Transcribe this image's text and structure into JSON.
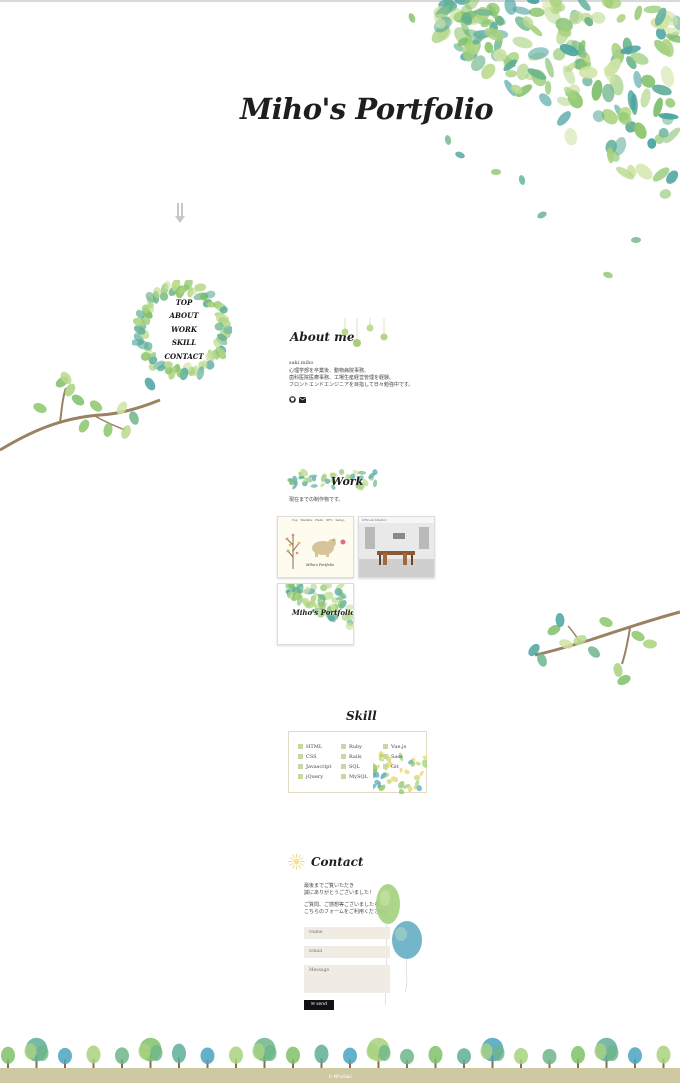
{
  "hero": {
    "title": "Miho's Portfolio"
  },
  "nav": {
    "items": [
      "TOP",
      "ABOUT",
      "WORK",
      "SKILL",
      "CONTACT"
    ]
  },
  "about": {
    "title": "About me",
    "name": "saki.miho",
    "lines": [
      "心理学部を卒業後、動物病院事務、",
      "歯科医院医療事務、工場生産経営管理を経験。",
      "フロントエンドエンジニアを目指して日々勉強中です。"
    ],
    "icons": [
      "github-icon",
      "envelope-icon"
    ]
  },
  "work": {
    "title": "Work",
    "intro": "現在までの制作物です。",
    "thumbs": [
      {
        "nav": "Top   Website   Hello   SFC   Setup",
        "caption": "Miho's Portfolio"
      },
      {
        "nav": "D'Room Interior"
      },
      {
        "caption": "Miho's Portfolio"
      }
    ]
  },
  "skill": {
    "title": "Skill",
    "columns": [
      [
        "HTML",
        "CSS",
        "Javascript",
        "jQuery"
      ],
      [
        "Ruby",
        "Rails",
        "SQL",
        "MySQL"
      ],
      [
        "Vue.js",
        "Sass",
        "Git"
      ]
    ]
  },
  "contact": {
    "title": "Contact",
    "lines": [
      "最後までご覧いただき",
      "誠にありがとうございました！",
      "",
      "ご質問、ご感想等ございましたら",
      "こちらのフォームをご利用ください。"
    ],
    "name_placeholder": "Name",
    "email_placeholder": "Email",
    "message_placeholder": "Message",
    "send_label": "send"
  },
  "footer": {
    "copyright": "© MihoSaki"
  },
  "colors": {
    "leaf_green": "#8cc66b",
    "leaf_teal": "#4aa3a0",
    "branch": "#9a8262",
    "ground": "#cfc9a3",
    "field_bg": "#f1ece3",
    "button": "#111111"
  }
}
